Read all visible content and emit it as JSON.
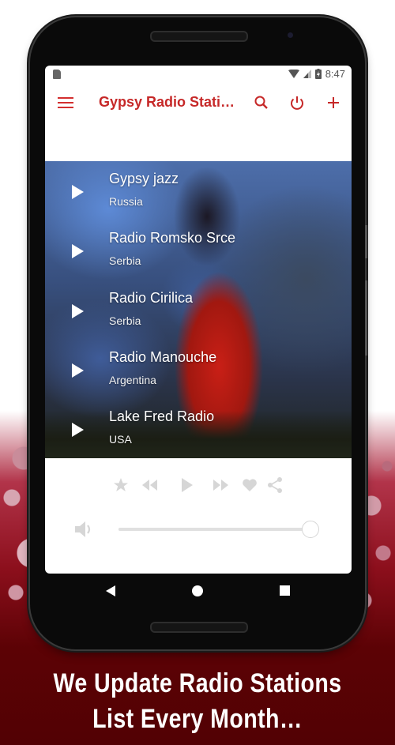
{
  "status_bar": {
    "time": "8:47",
    "icons": [
      "sd-card-icon",
      "wifi-icon",
      "signal-icon",
      "battery-charging-icon"
    ]
  },
  "app_bar": {
    "title": "Gypsy Radio Stati…",
    "actions": [
      "search-icon",
      "power-icon",
      "add-icon"
    ],
    "accent_color": "#c62828"
  },
  "stations": [
    {
      "name": "Gypsy jazz",
      "country": "Russia"
    },
    {
      "name": "Radio Romsko Srce",
      "country": "Serbia"
    },
    {
      "name": "Radio Cirilica",
      "country": "Serbia"
    },
    {
      "name": "Radio Manouche",
      "country": "Argentina"
    },
    {
      "name": "Lake Fred Radio",
      "country": "USA"
    }
  ],
  "player": {
    "controls": [
      "favorite-star-icon",
      "rewind-icon",
      "play-icon",
      "fast-forward-icon",
      "heart-icon",
      "share-icon"
    ],
    "volume_level": 1.0,
    "control_color": "#d6d6d6"
  },
  "nav_bar": [
    "back-icon",
    "home-icon",
    "recents-icon"
  ],
  "promo": {
    "line1": "We Update Radio Stations",
    "line2": "List Every Month…"
  }
}
